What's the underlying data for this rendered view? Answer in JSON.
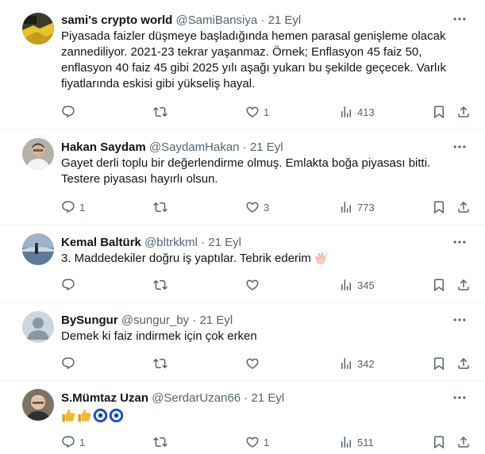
{
  "tweets": [
    {
      "name": "sami's crypto world",
      "handle": "@SamiBansiya",
      "dot": "·",
      "time": "21 Eyl",
      "text": "Piyasada faizler düşmeye başladığında hemen parasal genişleme olacak zannediliyor. 2021-23 tekrar yaşanmaz. Örnek; Enflasyon 45 faiz 50, enflasyon 40 faiz 45 gibi 2025 yılı aşağı yukarı bu şekilde geçecek. Varlık fiyatlarında eskisi gibi yükseliş hayal.",
      "replies": "",
      "retweets": "",
      "likes": "1",
      "views": "413"
    },
    {
      "name": "Hakan Saydam",
      "handle": "@SaydamHakan",
      "dot": "·",
      "time": "21 Eyl",
      "text": "Gayet derli toplu bir değerlendirme olmuş. Emlakta boğa piyasası bitti. Testere piyasası hayırlı olsun.",
      "replies": "1",
      "retweets": "",
      "likes": "3",
      "views": "773"
    },
    {
      "name": "Kemal Baltürk",
      "handle": "@bltrkkml",
      "dot": "·",
      "time": "21 Eyl",
      "text": "3. Maddedekiler doğru iş yaptılar. Tebrik ederim",
      "emoji": "clapping-hands",
      "replies": "",
      "retweets": "",
      "likes": "",
      "views": "345"
    },
    {
      "name": "BySungur",
      "handle": "@sungur_by",
      "dot": "·",
      "time": "21 Eyl",
      "text": "Demek ki faiz indirmek için çok erken",
      "replies": "",
      "retweets": "",
      "likes": "",
      "views": "342"
    },
    {
      "name": "S.Mümtaz Uzan",
      "handle": "@SerdarUzan66",
      "dot": "·",
      "time": "21 Eyl",
      "emojis": [
        "thumbs-up",
        "thumbs-up",
        "nazar-amulet",
        "nazar-amulet"
      ],
      "replies": "1",
      "retweets": "",
      "likes": "1",
      "views": "511"
    }
  ],
  "colors": {
    "text": "#0f1419",
    "secondary": "#536471",
    "divider": "#eff3f4"
  }
}
